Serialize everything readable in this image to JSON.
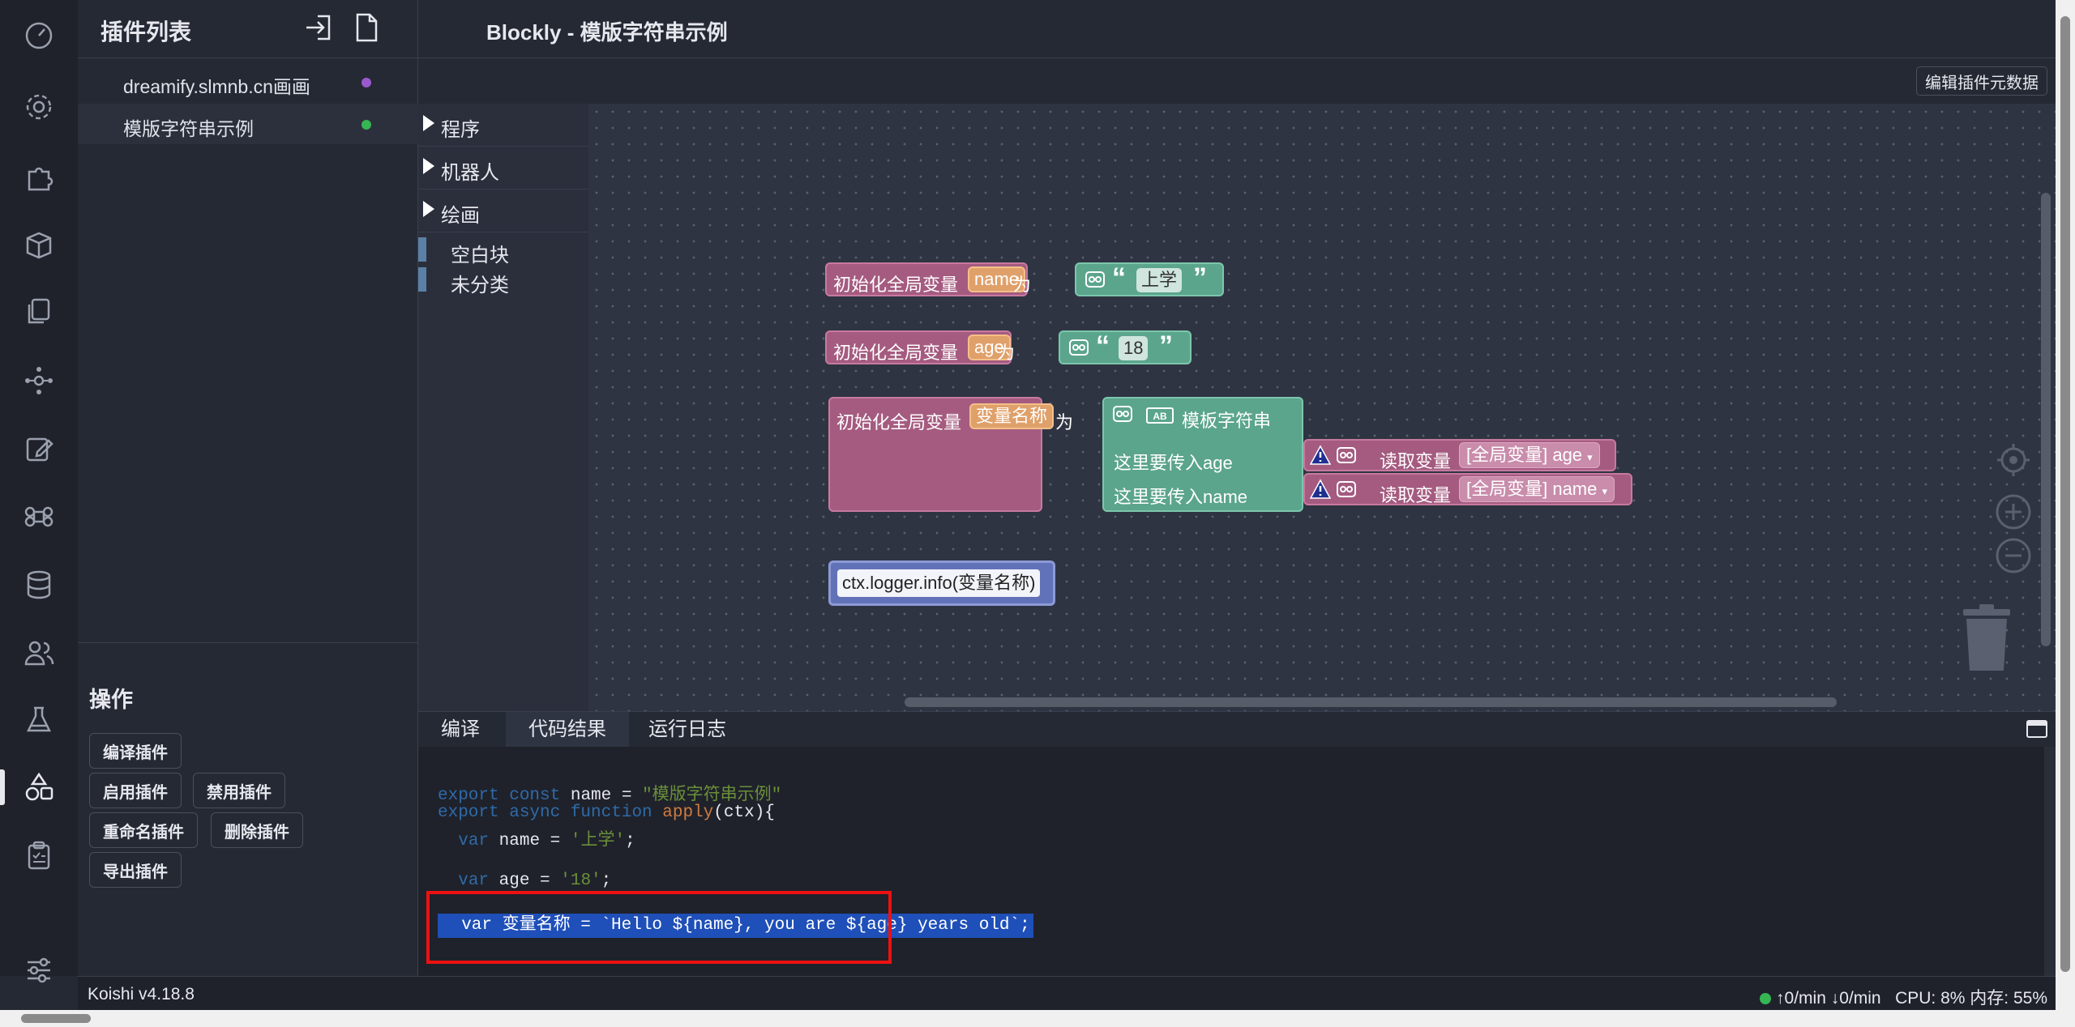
{
  "activity_bar": {
    "items": [
      {
        "icon": "dashboard-icon"
      },
      {
        "icon": "settings-icon"
      },
      {
        "icon": "puzzle-icon"
      },
      {
        "icon": "package-icon"
      },
      {
        "icon": "files-icon"
      },
      {
        "icon": "network-icon"
      },
      {
        "icon": "edit-icon"
      },
      {
        "icon": "command-icon"
      },
      {
        "icon": "database-icon"
      },
      {
        "icon": "users-icon"
      },
      {
        "icon": "flask-icon"
      },
      {
        "icon": "shapes-icon",
        "active": true
      },
      {
        "icon": "clipboard-icon"
      },
      {
        "icon": "sliders-icon"
      }
    ]
  },
  "sidebar": {
    "title": "插件列表",
    "plugins": [
      {
        "label": "dreamify.slmnb.cn画画",
        "dot_color": "#9b59d0"
      },
      {
        "label": "模版字符串示例",
        "dot_color": "#36b553"
      }
    ],
    "operations": {
      "title": "操作",
      "buttons": {
        "compile": "编译插件",
        "enable": "启用插件",
        "disable": "禁用插件",
        "rename": "重命名插件",
        "delete": "删除插件",
        "export": "导出插件"
      }
    }
  },
  "header": {
    "title": "Blockly - 模版字符串示例",
    "edit_meta_button": "编辑插件元数据"
  },
  "toolbox": {
    "categories": [
      "程序",
      "机器人",
      "绘画"
    ],
    "simple_categories": [
      "空白块",
      "未分类"
    ]
  },
  "blocks": {
    "init_label": "初始化全局变量",
    "as_label": "为",
    "var1": {
      "name": "name",
      "value": "上学"
    },
    "var2": {
      "name": "age",
      "value": "18"
    },
    "var3": {
      "name": "变量名称",
      "template_label": "模板字符串",
      "input1_label": "这里要传入age",
      "input2_label": "这里要传入name",
      "get_label": "读取变量",
      "get1_value": "[全局变量] age",
      "get2_value": "[全局变量] name"
    },
    "logger": "ctx.logger.info(变量名称)"
  },
  "panel": {
    "tabs": [
      "编译",
      "代码结果",
      "运行日志"
    ],
    "active_tab": "代码结果",
    "code": {
      "l1_kw": "export const",
      "l1_rest": " name = ",
      "l1_str": "\"模版字符串示例\"",
      "l2_kw": "export async function",
      "l2_fn": "apply",
      "l2_rest": "(ctx){",
      "l3_kw": "var",
      "l3_rest": " name = ",
      "l3_str": "'上学'",
      "l3_end": ";",
      "l4_kw": "var",
      "l4_rest": " age = ",
      "l4_str": "'18'",
      "l4_end": ";",
      "l5": "  var 变量名称 = `Hello ${name}, you are ${age} years old`;"
    }
  },
  "statusbar": {
    "version": "Koishi v4.18.8",
    "traffic": "↑0/min ↓0/min",
    "resources": "CPU: 8% 内存: 55%"
  }
}
